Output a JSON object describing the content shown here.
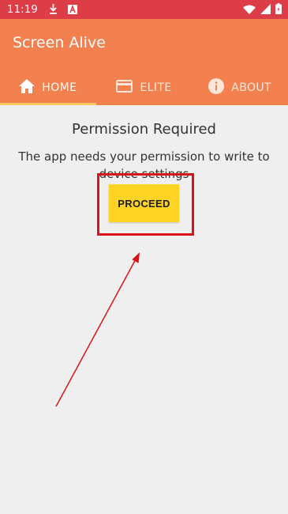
{
  "status_bar": {
    "time": "11:19",
    "left_icons": [
      "download-icon",
      "app-a-icon"
    ],
    "right_icons": [
      "wifi-icon",
      "signal-icon",
      "battery-icon"
    ]
  },
  "app": {
    "title": "Screen Alive",
    "tabs": [
      {
        "label": "HOME",
        "icon": "home-icon",
        "active": true
      },
      {
        "label": "ELITE",
        "icon": "card-icon",
        "active": false
      },
      {
        "label": "ABOUT",
        "icon": "info-icon",
        "active": false
      }
    ]
  },
  "main": {
    "heading": "Permission Required",
    "description": "The app needs your permission to write to device settings",
    "proceed_label": "PROCEED"
  },
  "colors": {
    "status_bar": "#dc3d46",
    "app_bar": "#f2814f",
    "tab_indicator": "#ffc85c",
    "button": "#fdd324",
    "annotation": "#d8141a"
  }
}
